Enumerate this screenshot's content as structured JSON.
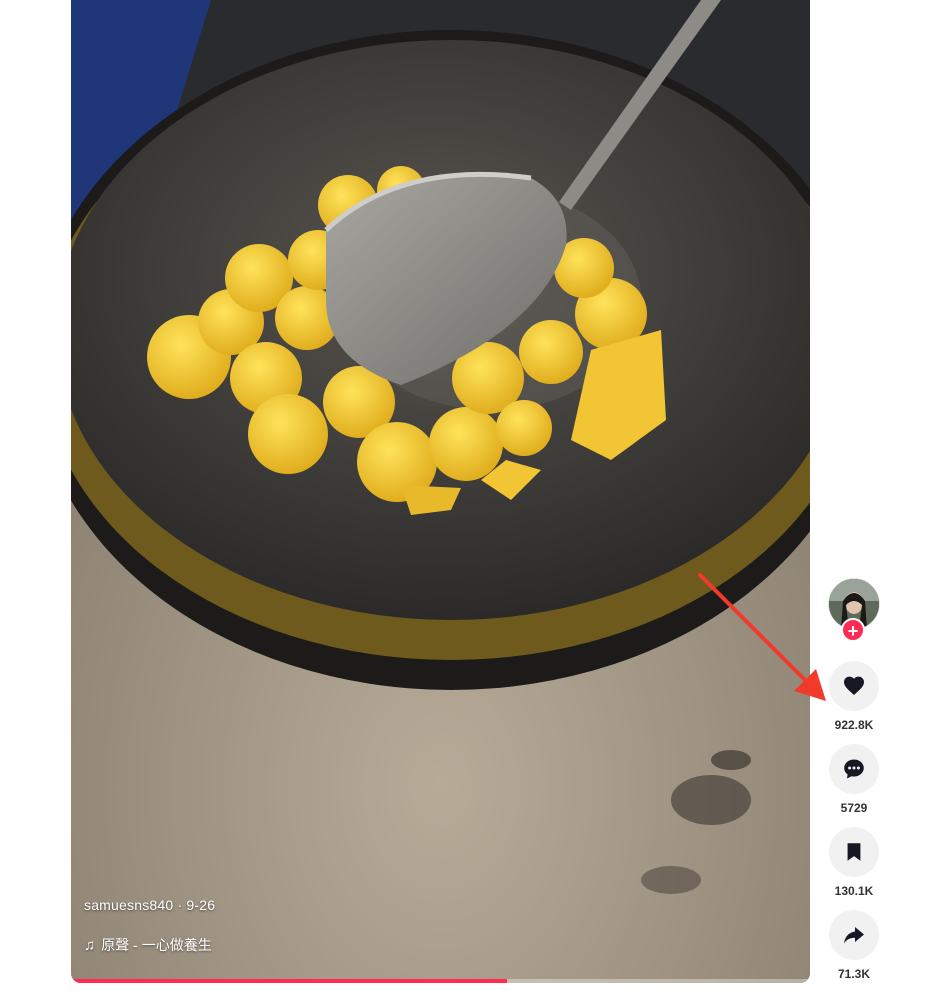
{
  "video": {
    "author": "samuesns840",
    "separator": " · ",
    "date": "9-26",
    "music": "原聲 - 一心做養生",
    "progress": 0.59
  },
  "actions": {
    "likes": "922.8K",
    "comments": "5729",
    "saves": "130.1K",
    "shares": "71.3K"
  },
  "colors": {
    "accent": "#fe2c55",
    "annotation_arrow": "#f23a2a"
  },
  "icons": [
    "music-note-icon",
    "plus-icon",
    "heart-icon",
    "comment-icon",
    "bookmark-icon",
    "share-icon"
  ]
}
